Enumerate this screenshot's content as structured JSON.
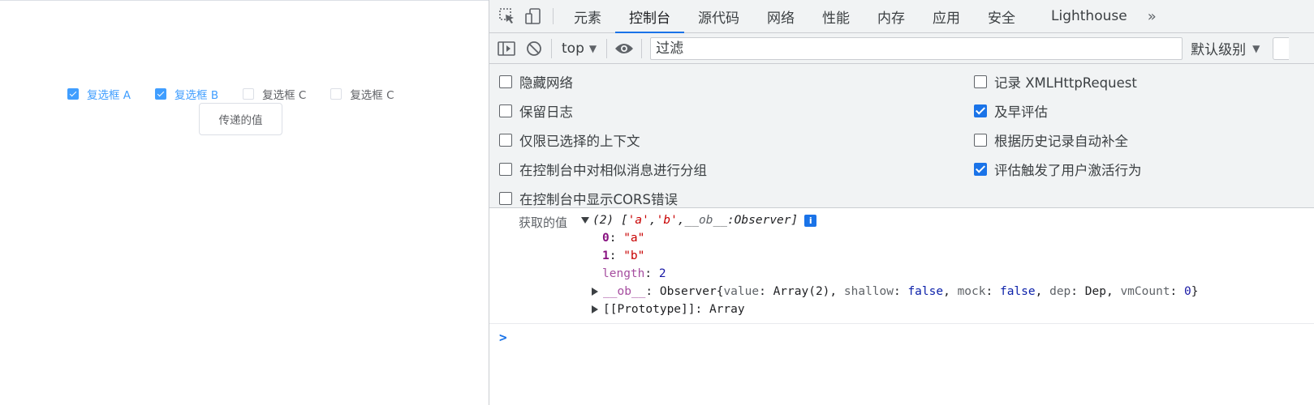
{
  "page": {
    "checkboxes": [
      {
        "label": "复选框 A",
        "checked": true
      },
      {
        "label": "复选框 B",
        "checked": true
      },
      {
        "label": "复选框 C",
        "checked": false
      },
      {
        "label": "复选框 C",
        "checked": false
      }
    ],
    "button_label": "传递的值"
  },
  "devtools": {
    "tabs": [
      {
        "label": "元素",
        "active": false
      },
      {
        "label": "控制台",
        "active": true
      },
      {
        "label": "源代码",
        "active": false
      },
      {
        "label": "网络",
        "active": false
      },
      {
        "label": "性能",
        "active": false
      },
      {
        "label": "内存",
        "active": false
      },
      {
        "label": "应用",
        "active": false
      },
      {
        "label": "安全",
        "active": false
      },
      {
        "label": "Lighthouse",
        "active": false
      }
    ],
    "more_tabs_glyph": "»",
    "toolbar": {
      "context": "top",
      "filter_placeholder": "过滤",
      "level": "默认级别"
    },
    "settings_left": [
      {
        "label": "隐藏网络",
        "checked": false
      },
      {
        "label": "保留日志",
        "checked": false
      },
      {
        "label": "仅限已选择的上下文",
        "checked": false
      },
      {
        "label": "在控制台中对相似消息进行分组",
        "checked": false
      },
      {
        "label": "在控制台中显示CORS错误",
        "checked": false
      }
    ],
    "settings_right": [
      {
        "label": "记录 XMLHttpRequest",
        "checked": false
      },
      {
        "label": "及早评估",
        "checked": true
      },
      {
        "label": "根据历史记录自动补全",
        "checked": false
      },
      {
        "label": "评估触发了用户激活行为",
        "checked": true
      }
    ],
    "console": {
      "log_prefix": "获取的值",
      "summary": {
        "count": "(2)",
        "open": "[",
        "item_a": "'a'",
        "comma1": ", ",
        "item_b": "'b'",
        "comma2": ", ",
        "ob_key": "__ob__",
        "colon": ": ",
        "ob_val": "Observer",
        "close": "]"
      },
      "info_badge": "i",
      "entries": [
        {
          "key": "0",
          "value": "\"a\""
        },
        {
          "key": "1",
          "value": "\"b\""
        },
        {
          "key": "length",
          "value": "2"
        }
      ],
      "ob_line": {
        "key": "__ob__",
        "type": "Observer",
        "body_open": " {",
        "k1": "value",
        "v1": "Array(2)",
        "k2": "shallow",
        "v2": "false",
        "k3": "mock",
        "v3": "false",
        "k4": "dep",
        "v4": "Dep",
        "k5": "vmCount",
        "v5": "0",
        "body_close": "}"
      },
      "proto_line": {
        "key": "[[Prototype]]",
        "value": "Array"
      },
      "prompt": ">"
    }
  }
}
